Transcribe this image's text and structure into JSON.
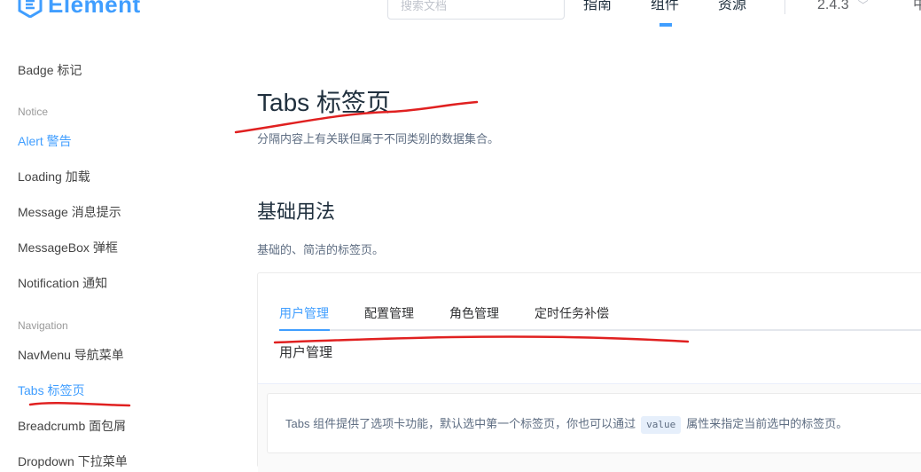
{
  "header": {
    "logo_text": "Element",
    "search_placeholder": "搜索文档",
    "nav": [
      {
        "label": "指南"
      },
      {
        "label": "组件"
      },
      {
        "label": "资源"
      }
    ],
    "version": "2.4.3",
    "lang": "中"
  },
  "sidebar": {
    "items": [
      {
        "label": "Badge 标记",
        "type": "item"
      },
      {
        "label": "Notice",
        "type": "group"
      },
      {
        "label": "Alert 警告",
        "type": "item"
      },
      {
        "label": "Loading 加载",
        "type": "item"
      },
      {
        "label": "Message 消息提示",
        "type": "item"
      },
      {
        "label": "MessageBox 弹框",
        "type": "item"
      },
      {
        "label": "Notification 通知",
        "type": "item"
      },
      {
        "label": "Navigation",
        "type": "group"
      },
      {
        "label": "NavMenu 导航菜单",
        "type": "item"
      },
      {
        "label": "Tabs 标签页",
        "type": "item",
        "active": true
      },
      {
        "label": "Breadcrumb 面包屑",
        "type": "item"
      },
      {
        "label": "Dropdown 下拉菜单",
        "type": "item"
      }
    ]
  },
  "main": {
    "title": "Tabs 标签页",
    "description": "分隔内容上有关联但属于不同类别的数据集合。",
    "section_title": "基础用法",
    "section_description": "基础的、简洁的标签页。",
    "tabs": [
      {
        "label": "用户管理",
        "active": true
      },
      {
        "label": "配置管理"
      },
      {
        "label": "角色管理"
      },
      {
        "label": "定时任务补偿"
      }
    ],
    "tab_content": "用户管理",
    "tip": {
      "before": "Tabs 组件提供了选项卡功能，默认选中第一个标签页，你也可以通过",
      "code": "value",
      "after": "属性来指定当前选中的标签页。"
    }
  },
  "colors": {
    "primary": "#409eff",
    "annotation": "#e02020"
  }
}
